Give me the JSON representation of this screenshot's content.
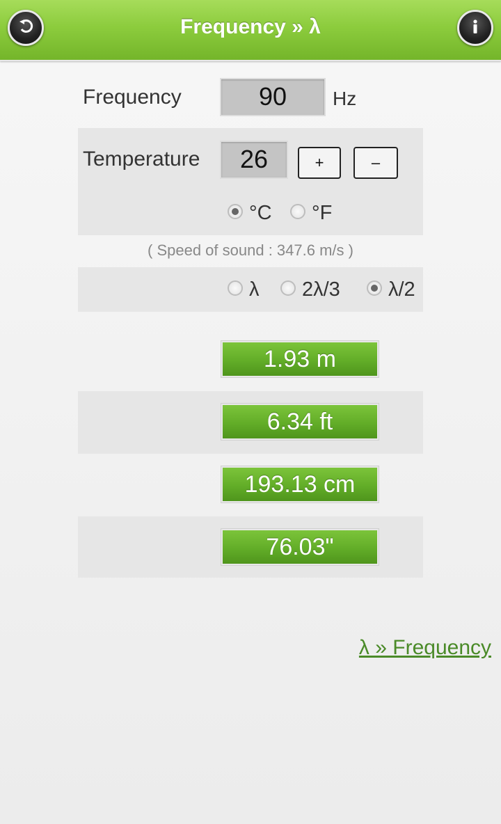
{
  "header": {
    "title": "Frequency » λ"
  },
  "frequency": {
    "label": "Frequency",
    "value": "90",
    "unit": "Hz"
  },
  "temperature": {
    "label": "Temperature",
    "value": "26",
    "plus_label": "+",
    "minus_label": "–"
  },
  "temp_units": {
    "celsius": "°C",
    "fahrenheit": "°F",
    "selected": "°C"
  },
  "speed_of_sound": "( Speed of sound : 347.6 m/s )",
  "fraction": {
    "full": "λ",
    "two_thirds": "2λ/3",
    "half": "λ/2",
    "selected": "λ/2"
  },
  "results": [
    "1.93 m",
    "6.34 ft",
    "193.13 cm",
    "76.03\""
  ],
  "link": "λ » Frequency",
  "colors": {
    "header_green": "#8ccc3d",
    "result_green": "#62ad28",
    "link_green": "#4a8a28"
  }
}
